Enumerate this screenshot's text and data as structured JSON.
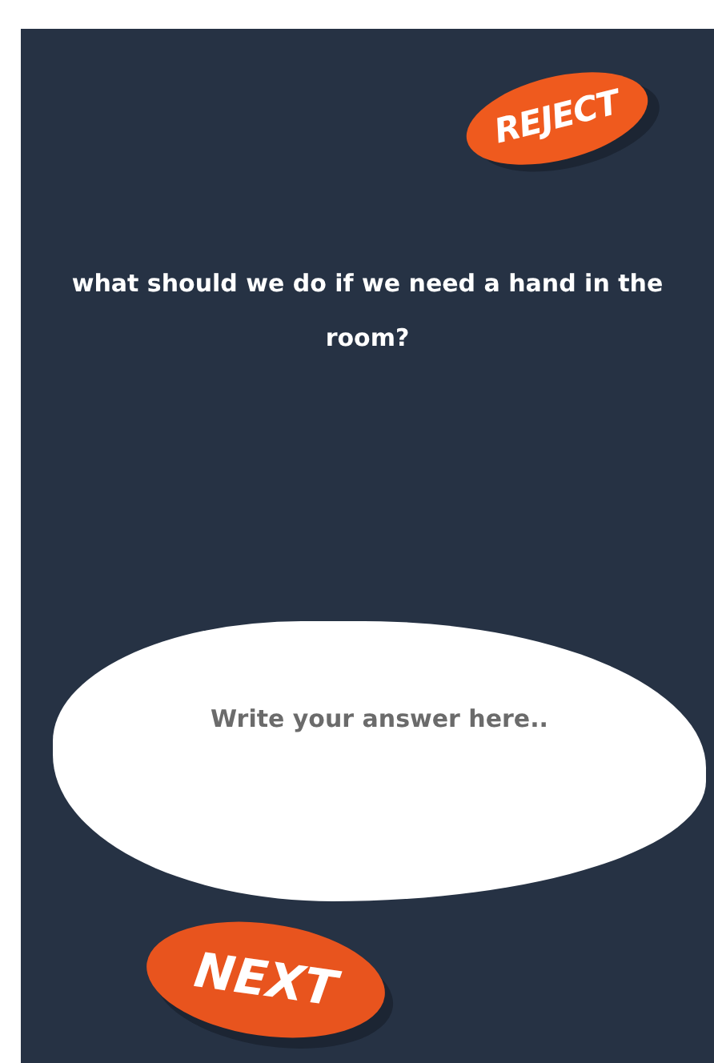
{
  "reject_button": {
    "label": "REJECT"
  },
  "question": "what should we do if we need a hand in the room?",
  "answer": {
    "placeholder": "Write your answer here.."
  },
  "next_button": {
    "label": "NEXT"
  }
}
